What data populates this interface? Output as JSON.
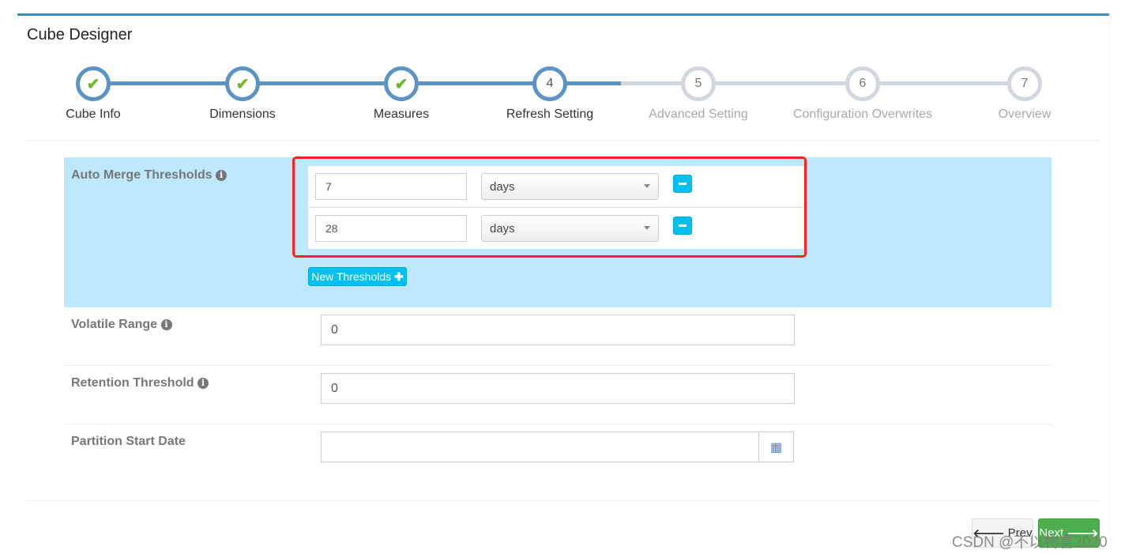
{
  "title": "Cube Designer",
  "steps": [
    {
      "label": "Cube Info",
      "state": "done"
    },
    {
      "label": "Dimensions",
      "state": "done"
    },
    {
      "label": "Measures",
      "state": "done"
    },
    {
      "label": "Refresh Setting",
      "number": "4",
      "state": "current"
    },
    {
      "label": "Advanced Setting",
      "number": "5",
      "state": "todo"
    },
    {
      "label": "Configuration Overwrites",
      "number": "6",
      "state": "todo"
    },
    {
      "label": "Overview",
      "number": "7",
      "state": "todo"
    }
  ],
  "form": {
    "auto_merge": {
      "label": "Auto Merge Thresholds",
      "thresholds": [
        {
          "value": "7",
          "unit": "days"
        },
        {
          "value": "28",
          "unit": "days"
        }
      ],
      "new_button": "New Thresholds"
    },
    "volatile": {
      "label": "Volatile Range",
      "value": "0"
    },
    "retention": {
      "label": "Retention Threshold",
      "value": "0"
    },
    "partition": {
      "label": "Partition Start Date",
      "value": ""
    }
  },
  "nav": {
    "prev": "Prev",
    "next": "Next"
  },
  "watermark": "CSDN @不以物喜2020",
  "colors": {
    "accent": "#3c8dbc",
    "highlight": "#bde8fd",
    "info_button": "#00c0ef",
    "next": "#4cae4c",
    "annotation": "#ff2020"
  }
}
